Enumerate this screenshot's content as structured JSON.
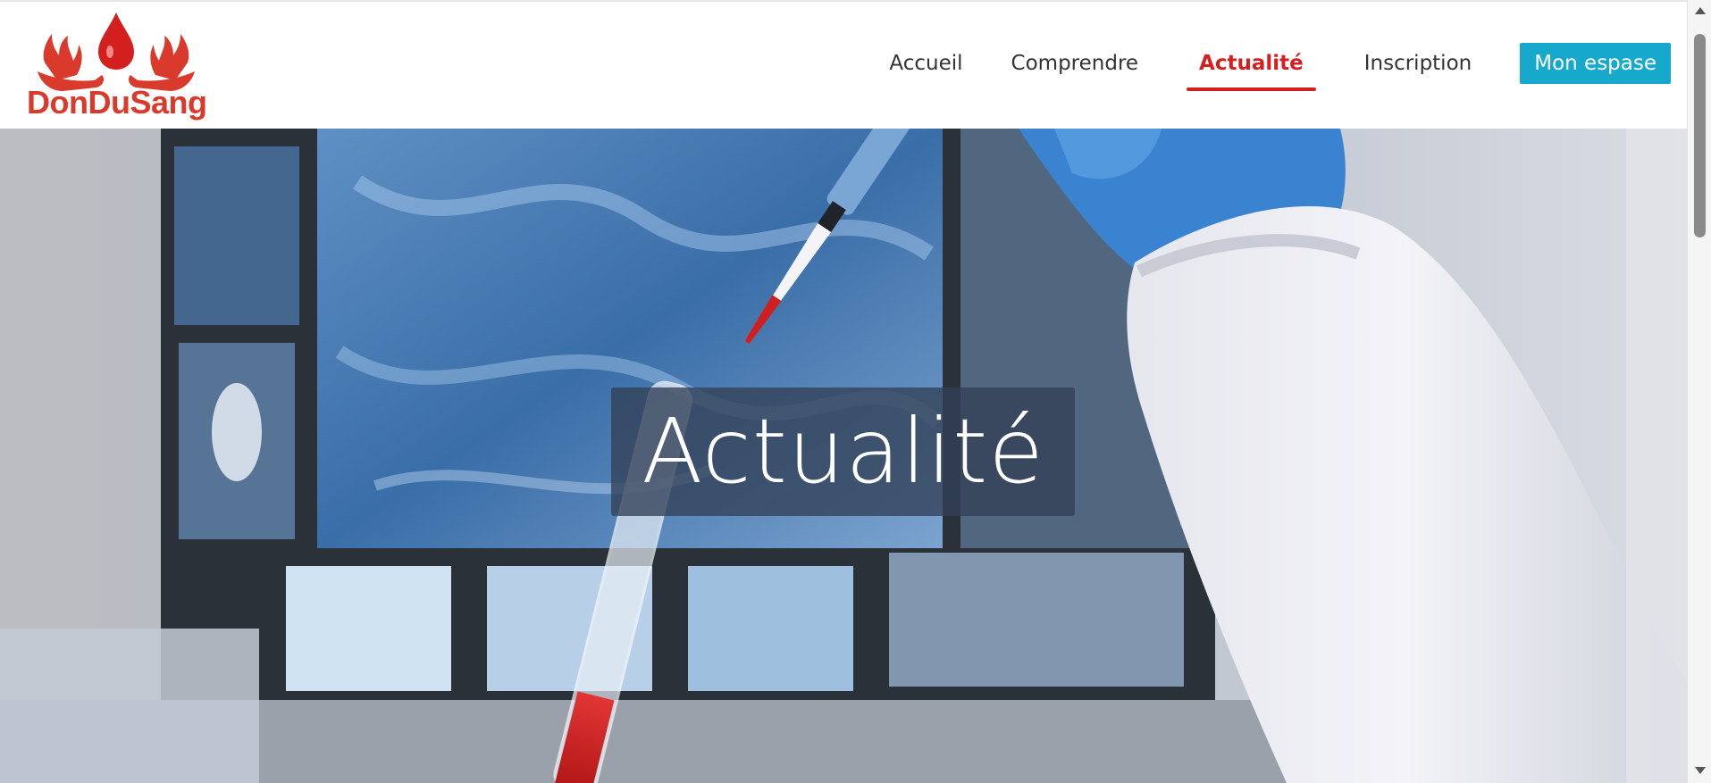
{
  "brand": {
    "name": "DonDuSang",
    "logo_icon": "blood-drop-hands-icon",
    "color": "#d93a2b"
  },
  "nav": {
    "items": [
      {
        "label": "Accueil",
        "active": false
      },
      {
        "label": "Comprendre",
        "active": false
      },
      {
        "label": "Actualité",
        "active": true
      },
      {
        "label": "Inscription",
        "active": false
      }
    ],
    "account_button": "Mon espase",
    "active_color": "#d41f1f",
    "button_color": "#17a9cb"
  },
  "hero": {
    "title": "Actualité",
    "image": "laboratory-pipette-blood-sample-photo"
  }
}
